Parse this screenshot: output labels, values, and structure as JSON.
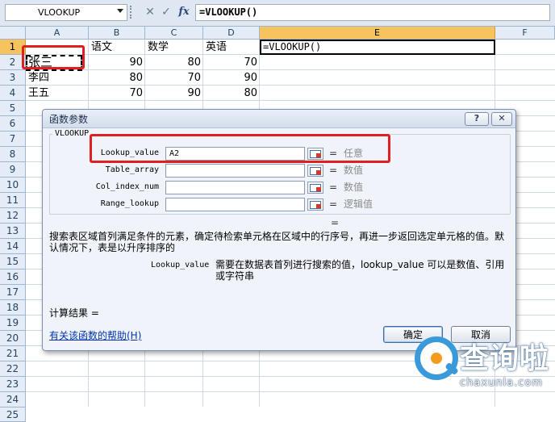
{
  "formula_bar": {
    "name_box": "VLOOKUP",
    "cancel_glyph": "✕",
    "enter_glyph": "✓",
    "fx_glyph": "fx",
    "formula": "=VLOOKUP()"
  },
  "sheet": {
    "columns": [
      "A",
      "B",
      "C",
      "D",
      "E",
      "F"
    ],
    "active_column": "E",
    "rows": [
      "1",
      "2",
      "3",
      "4",
      "5",
      "6",
      "7",
      "8",
      "9",
      "10",
      "11",
      "12",
      "13",
      "14",
      "15",
      "16",
      "17",
      "18",
      "19",
      "20",
      "21",
      "22",
      "23",
      "24",
      "25"
    ],
    "active_row": "1",
    "cells": {
      "B1": "语文",
      "C1": "数学",
      "D1": "英语",
      "E1": "=VLOOKUP()",
      "A2": "张三",
      "B2": "90",
      "C2": "80",
      "D2": "70",
      "A3": "李四",
      "B3": "80",
      "C3": "70",
      "D3": "90",
      "A4": "王五",
      "B4": "70",
      "C4": "90",
      "D4": "80"
    }
  },
  "dialog": {
    "title": "函数参数",
    "help_label": "?",
    "close_label": "✕",
    "function_name": "VLOOKUP",
    "args": [
      {
        "label": "Lookup_value",
        "value": "A2",
        "eq": "=",
        "hint": "任意"
      },
      {
        "label": "Table_array",
        "value": "",
        "eq": "=",
        "hint": "数值"
      },
      {
        "label": "Col_index_num",
        "value": "",
        "eq": "=",
        "hint": "数值"
      },
      {
        "label": "Range_lookup",
        "value": "",
        "eq": "=",
        "hint": "逻辑值"
      }
    ],
    "result_eq": "=",
    "description": "搜索表区域首列满足条件的元素，确定待检索单元格在区域中的行序号，再进一步返回选定单元格的值。默认情况下，表是以升序排序的",
    "arg_desc_name": "Lookup_value",
    "arg_desc_text": "需要在数据表首列进行搜索的值，lookup_value 可以是数值、引用或字符串",
    "calc_result": "计算结果 =",
    "help_link": "有关该函数的帮助(H)",
    "ok_label": "确定",
    "cancel_label": "取消"
  },
  "watermark": {
    "text": "查询啦",
    "url": "chaxunla.com"
  },
  "colors": {
    "highlight": "#e02020",
    "active_header": "#f6c35e",
    "watermark_blue": "#3a9ad9",
    "watermark_orange": "#f29b1d"
  }
}
